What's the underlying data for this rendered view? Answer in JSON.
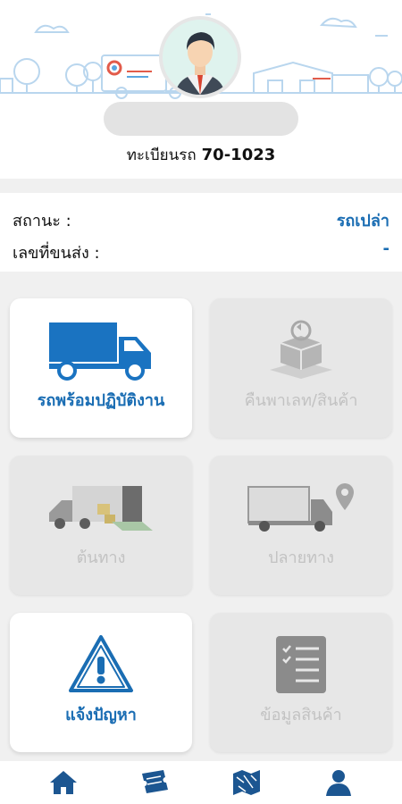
{
  "profile": {
    "plate_label": "ทะเบียนรถ",
    "plate_number": "70-1023"
  },
  "status": {
    "status_label": "สถานะ :",
    "status_value": "รถเปล่า",
    "shipment_label": "เลขที่ขนส่ง :",
    "shipment_value": "-"
  },
  "menu": [
    {
      "label": "รถพร้อมปฏิบัติงาน",
      "icon": "truck-icon",
      "enabled": true
    },
    {
      "label": "คืนพาเลท/สินค้า",
      "icon": "pallet-return-icon",
      "enabled": false
    },
    {
      "label": "ต้นทาง",
      "icon": "loading-truck-icon",
      "enabled": false
    },
    {
      "label": "ปลายทาง",
      "icon": "destination-truck-icon",
      "enabled": false
    },
    {
      "label": "แจ้งปัญหา",
      "icon": "warning-icon",
      "enabled": true
    },
    {
      "label": "ข้อมูลสินค้า",
      "icon": "checklist-icon",
      "enabled": false
    }
  ],
  "tabbar": [
    {
      "icon": "home-icon"
    },
    {
      "icon": "ticket-icon"
    },
    {
      "icon": "map-icon"
    },
    {
      "icon": "user-icon"
    }
  ],
  "colors": {
    "accent": "#1a6db3",
    "disabled_text": "#c2c2c2",
    "tab_icon": "#1c5691"
  }
}
